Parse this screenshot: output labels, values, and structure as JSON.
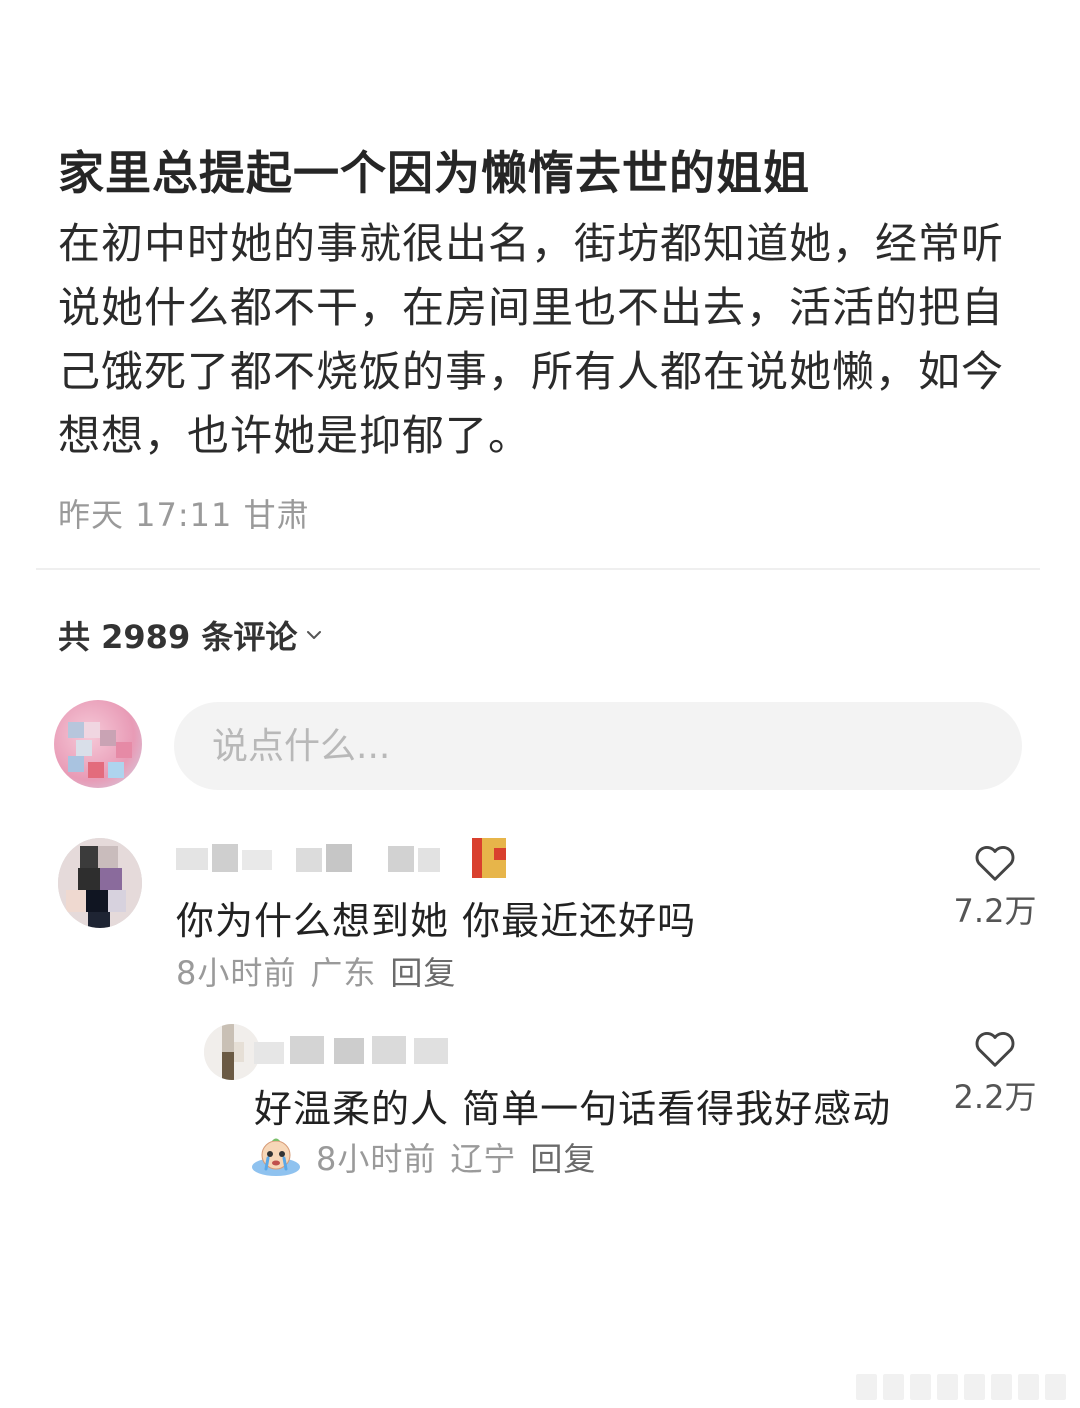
{
  "post": {
    "title": "家里总提起一个因为懒惰去世的姐姐",
    "body": "在初中时她的事就很出名，街坊都知道她，经常听说她什么都不干，在房间里也不出去，活活的把自己饿死了都不烧饭的事，所有人都在说她懒，如今想想，也许她是抑郁了。",
    "time": "昨天 17:11",
    "location": "甘肃"
  },
  "comments_header": {
    "count_label": "共 2989 条评论",
    "chevron_icon": "chevron-down-icon"
  },
  "input": {
    "placeholder": "说点什么..."
  },
  "comments": [
    {
      "text": "你为什么想到她 你最近还好吗",
      "time": "8小时前",
      "location": "广东",
      "reply_label": "回复",
      "likes": "7.2万",
      "like_icon": "heart-icon"
    }
  ],
  "replies": [
    {
      "text": "好温柔的人 简单一句话看得我好感动",
      "time": "8小时前",
      "location": "辽宁",
      "reply_label": "回复",
      "likes": "2.2万",
      "like_icon": "heart-icon",
      "emoji_icon": "crying-emoji-icon"
    }
  ],
  "colors": {
    "text_primary": "#222222",
    "text_secondary": "#9a9a9a",
    "input_bg": "#f3f3f3",
    "divider": "#efefef"
  }
}
